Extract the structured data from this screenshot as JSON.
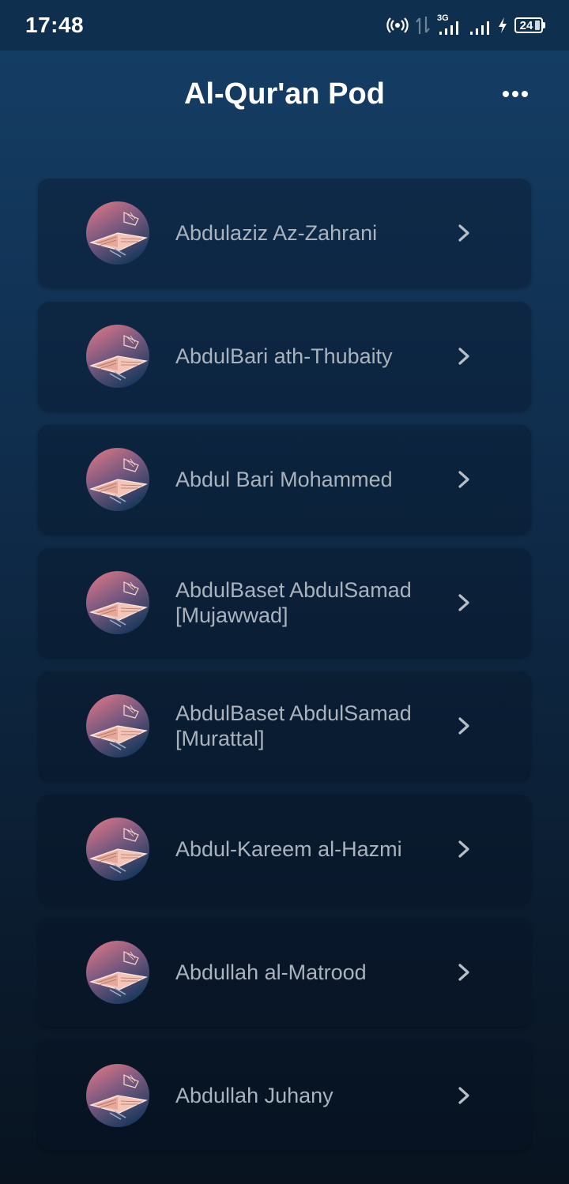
{
  "status_bar": {
    "time": "17:48",
    "network_type": "3G",
    "battery_level": "24"
  },
  "header": {
    "title": "Al-Qur'an Pod",
    "menu_icon": "more-horizontal-icon"
  },
  "reciters": [
    {
      "name": "Abdulaziz Az-Zahrani"
    },
    {
      "name": "AbdulBari ath-Thubaity"
    },
    {
      "name": "Abdul Bari Mohammed"
    },
    {
      "name": "AbdulBaset AbdulSamad [Mujawwad]"
    },
    {
      "name": "AbdulBaset AbdulSamad [Murattal]"
    },
    {
      "name": "Abdul-Kareem al-Hazmi"
    },
    {
      "name": "Abdullah al-Matrood"
    },
    {
      "name": "Abdullah Juhany"
    }
  ],
  "colors": {
    "background_top": "#153f67",
    "background_bottom": "#08131f",
    "status_bar": "#0f2f4f",
    "reciter_text": "#aab3bd",
    "chevron": "#b7bec7"
  }
}
